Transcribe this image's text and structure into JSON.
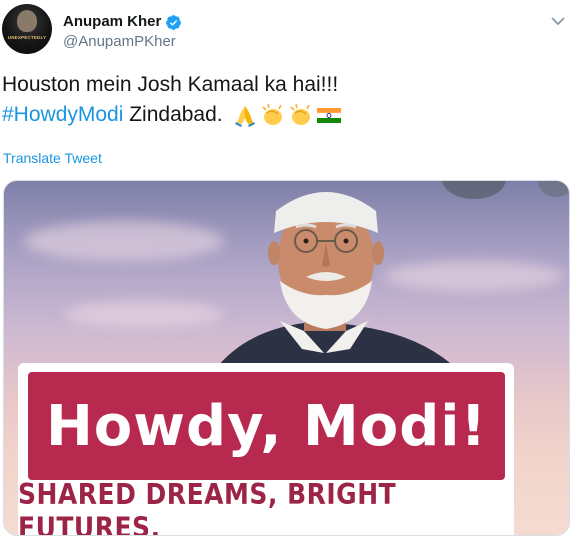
{
  "tweet": {
    "author": {
      "display_name": "Anupam Kher",
      "handle": "@AnupamPKher",
      "verified": true,
      "avatar_text": "UNEXPECTEDLY"
    },
    "text": {
      "line1": "Houston mein Josh Kamaal ka hai!!!",
      "hashtag": "#HowdyModi",
      "line2_rest": " Zindabad. ",
      "emojis": [
        "folded-hands",
        "clapping-hands",
        "clapping-hands",
        "india-flag"
      ]
    },
    "translate_label": "Translate Tweet",
    "media": {
      "sign_title": "Howdy, Modi!",
      "sign_subtitle": "SHARED DREAMS, BRIGHT FUTURES."
    }
  },
  "colors": {
    "link": "#1b95e0",
    "text": "#14171a",
    "secondary": "#657786",
    "sign_red": "#b7294f"
  }
}
